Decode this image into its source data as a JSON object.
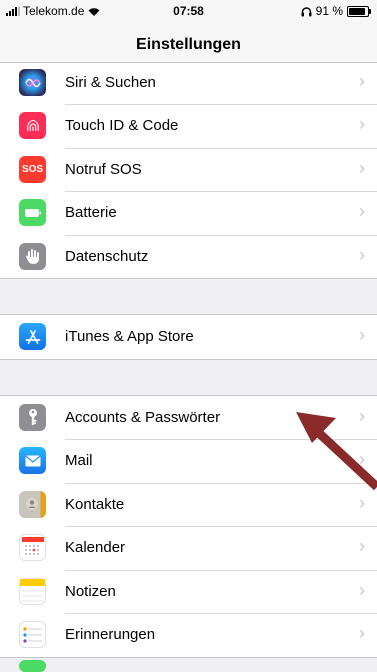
{
  "status_bar": {
    "carrier": "Telekom.de",
    "time": "07:58",
    "battery": "91 %"
  },
  "nav": {
    "title": "Einstellungen"
  },
  "groups": [
    [
      {
        "label": "Siri & Suchen",
        "icon": "siri-icon",
        "color": "#2d2d5c"
      },
      {
        "label": "Touch ID & Code",
        "icon": "fingerprint-icon",
        "color": "#ff2d55"
      },
      {
        "label": "Notruf SOS",
        "icon": "sos-icon",
        "color": "#ff3b30"
      },
      {
        "label": "Batterie",
        "icon": "battery-icon",
        "color": "#4cd964"
      },
      {
        "label": "Datenschutz",
        "icon": "hand-icon",
        "color": "#8e8e93"
      }
    ],
    [
      {
        "label": "iTunes & App Store",
        "icon": "app-store-icon",
        "color": "#1a8cff"
      }
    ],
    [
      {
        "label": "Accounts & Passwörter",
        "icon": "key-icon",
        "color": "#8e8e93"
      },
      {
        "label": "Mail",
        "icon": "mail-icon",
        "color": "#1a8cff"
      },
      {
        "label": "Kontakte",
        "icon": "contacts-icon",
        "color": "#b8b5ad"
      },
      {
        "label": "Kalender",
        "icon": "calendar-icon",
        "color": "#ffffff"
      },
      {
        "label": "Notizen",
        "icon": "notes-icon",
        "color": "#ffcc00"
      },
      {
        "label": "Erinnerungen",
        "icon": "reminders-icon",
        "color": "#ffffff"
      }
    ]
  ],
  "annotation_color": "#8b2a2a"
}
